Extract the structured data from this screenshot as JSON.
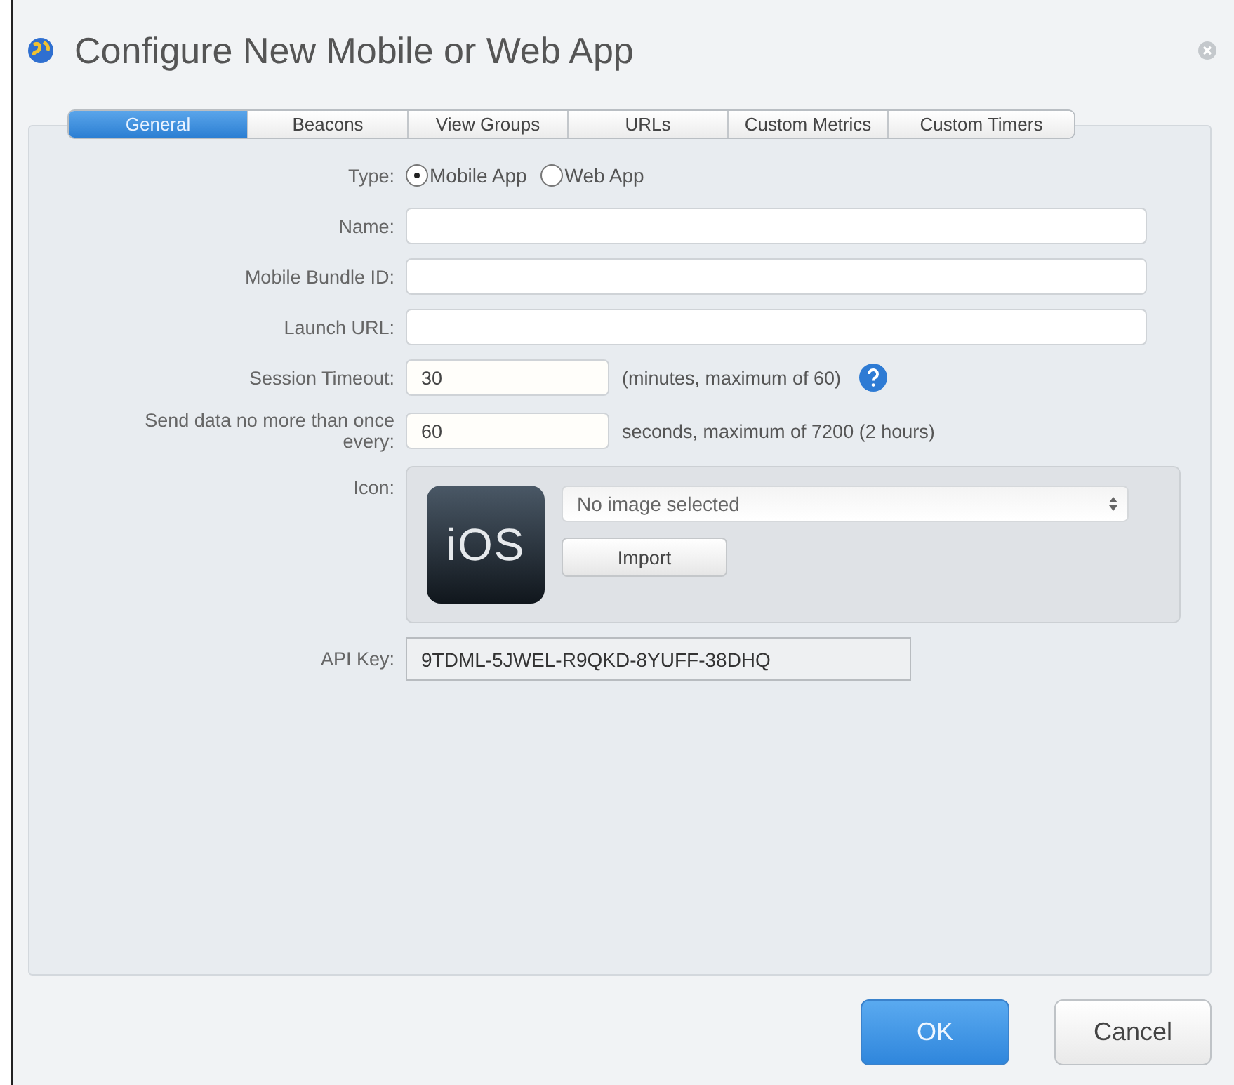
{
  "window": {
    "title": "Configure New Mobile or Web App"
  },
  "tabs": [
    {
      "label": "General",
      "selected": true
    },
    {
      "label": "Beacons",
      "selected": false
    },
    {
      "label": "View Groups",
      "selected": false
    },
    {
      "label": "URLs",
      "selected": false
    },
    {
      "label": "Custom Metrics",
      "selected": false
    },
    {
      "label": "Custom Timers",
      "selected": false
    }
  ],
  "form": {
    "type": {
      "label": "Type:",
      "options": [
        {
          "label": "Mobile App",
          "selected": true
        },
        {
          "label": "Web App",
          "selected": false
        }
      ]
    },
    "fields": [
      {
        "label": "Name:"
      },
      {
        "label": "Mobile Bundle ID:"
      },
      {
        "label": "Launch URL:"
      }
    ],
    "session_timeout": {
      "label": "Session Timeout:",
      "value": "30",
      "note": "(minutes, maximum of 60)"
    },
    "send_interval": {
      "label": "Send data no more than once every:",
      "value": "60",
      "note": "seconds, maximum of 7200 (2 hours)"
    },
    "icon": {
      "label": "Icon:",
      "icon_text": "iOS",
      "select_value": "No image selected",
      "import_button": "Import"
    },
    "api_key": {
      "label": "API Key:",
      "value": "9TDML-5JWEL-R9QKD-8YUFF-38DHQ"
    }
  },
  "buttons": [
    {
      "label": "OK",
      "kind": "primary"
    },
    {
      "label": "Cancel",
      "kind": "secondary"
    }
  ]
}
